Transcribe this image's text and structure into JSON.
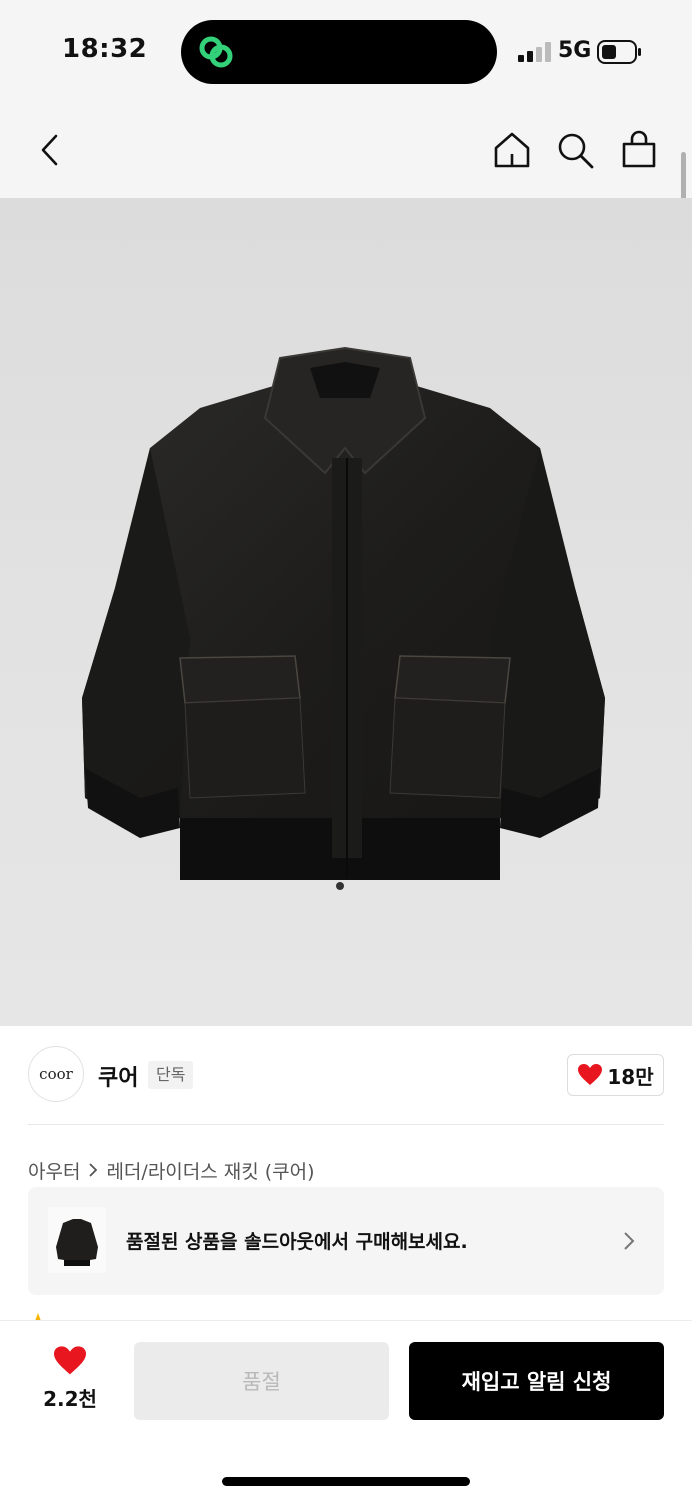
{
  "status_bar": {
    "time": "18:32",
    "network": "5G",
    "island_icon": "link-app-icon",
    "island_icon_color": "#33d17a"
  },
  "nav": {
    "back_icon": "chevron-left-icon",
    "home_icon": "home-icon",
    "search_icon": "search-icon",
    "bag_icon": "shopping-bag-icon"
  },
  "product": {
    "image_subject": "black leather bomber jacket",
    "expand_icon": "expand-icon"
  },
  "brand": {
    "logo_text": "coor",
    "name": "쿠어",
    "badge": "단독",
    "like_count": "18만",
    "heart_color": "#e8161f"
  },
  "breadcrumb": {
    "category": "아우터",
    "subcategory": "레더/라이더스 재킷 (쿠어)"
  },
  "soldout_banner": {
    "text": "품절된 상품을 솔드아웃에서 구매해보세요."
  },
  "bottom_bar": {
    "wish_count": "2.2천",
    "soldout_label": "품절",
    "restock_label": "재입고 알림 신청"
  }
}
